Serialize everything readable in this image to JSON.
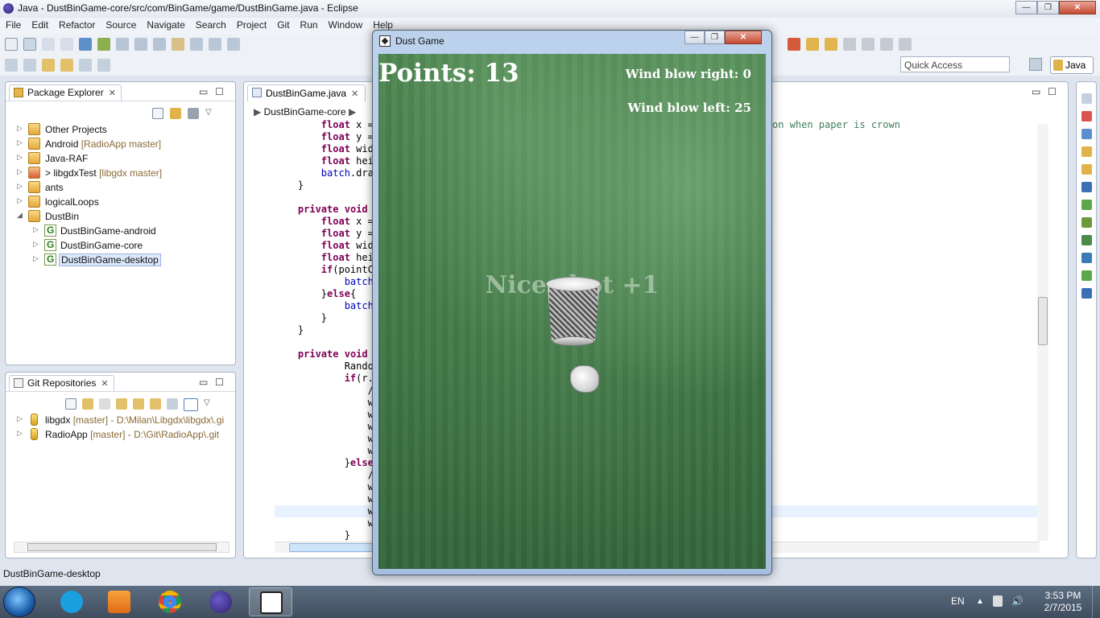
{
  "window": {
    "title": "Java - DustBinGame-core/src/com/BinGame/game/DustBinGame.java - Eclipse",
    "min_label": "—",
    "max_label": "❐",
    "close_label": "✕"
  },
  "menu": [
    "File",
    "Edit",
    "Refactor",
    "Source",
    "Navigate",
    "Search",
    "Project",
    "Git",
    "Run",
    "Window",
    "Help"
  ],
  "toolbar": {
    "quick_access_placeholder": "Quick Access",
    "perspective_label": "Java"
  },
  "package_explorer": {
    "title": "Package Explorer",
    "items": [
      {
        "label": "Other Projects",
        "decoration": "",
        "prefix": ""
      },
      {
        "label": "Android",
        "decoration": "[RadioApp master]",
        "prefix": ""
      },
      {
        "label": "Java-RAF",
        "decoration": "",
        "prefix": ""
      },
      {
        "label": "libgdxTest",
        "decoration": "[libgdx master]",
        "prefix": "> "
      },
      {
        "label": "ants",
        "decoration": "",
        "prefix": ""
      },
      {
        "label": "logicalLoops",
        "decoration": "",
        "prefix": ""
      },
      {
        "label": "DustBin",
        "decoration": "",
        "prefix": ""
      },
      {
        "label": "DustBinGame-android",
        "decoration": "",
        "prefix": ""
      },
      {
        "label": "DustBinGame-core",
        "decoration": "",
        "prefix": ""
      },
      {
        "label": "DustBinGame-desktop",
        "decoration": "",
        "prefix": ""
      }
    ]
  },
  "git_repos": {
    "title": "Git Repositories",
    "items": [
      {
        "label": "libgdx",
        "decoration": "[master] - D:\\Milan\\Libgdx\\libgdx\\.gi"
      },
      {
        "label": "RadioApp",
        "decoration": "[master] - D:\\Git\\RadioApp\\.git"
      }
    ]
  },
  "editor": {
    "tab_label": "DustBinGame.java",
    "breadcrumb": "DustBinGame-core",
    "trailing_comment": "on when paper is crown",
    "lines": [
      "        float x =",
      "        float y =",
      "        float wid",
      "        float hei",
      "        batch.dra",
      "    }",
      "",
      "    private void",
      "        float x =",
      "        float y =",
      "        float wid",
      "        float hei",
      "        if(pointC",
      "            batch",
      "        }else{",
      "            batch",
      "        }",
      "    }",
      "",
      "    private void",
      "            Rando",
      "            if(r.",
      "                /",
      "                w",
      "                w",
      "                w",
      "                w",
      "                w",
      "            }else",
      "                /",
      "                w",
      "                w",
      "                w",
      "                w",
      "            }"
    ]
  },
  "status_text": "DustBinGame-desktop",
  "game": {
    "title": "Dust Game",
    "points": "Points: 13",
    "wind_right": "Wind blow right: 0",
    "wind_left": "Wind blow left: 25",
    "message": "Nice shot +1"
  },
  "taskbar": {
    "language": "EN",
    "time": "3:53 PM",
    "date": "2/7/2015",
    "apps": [
      "skype-icon",
      "media-player-icon",
      "chrome-icon",
      "eclipse-icon",
      "dust-game-icon"
    ]
  }
}
